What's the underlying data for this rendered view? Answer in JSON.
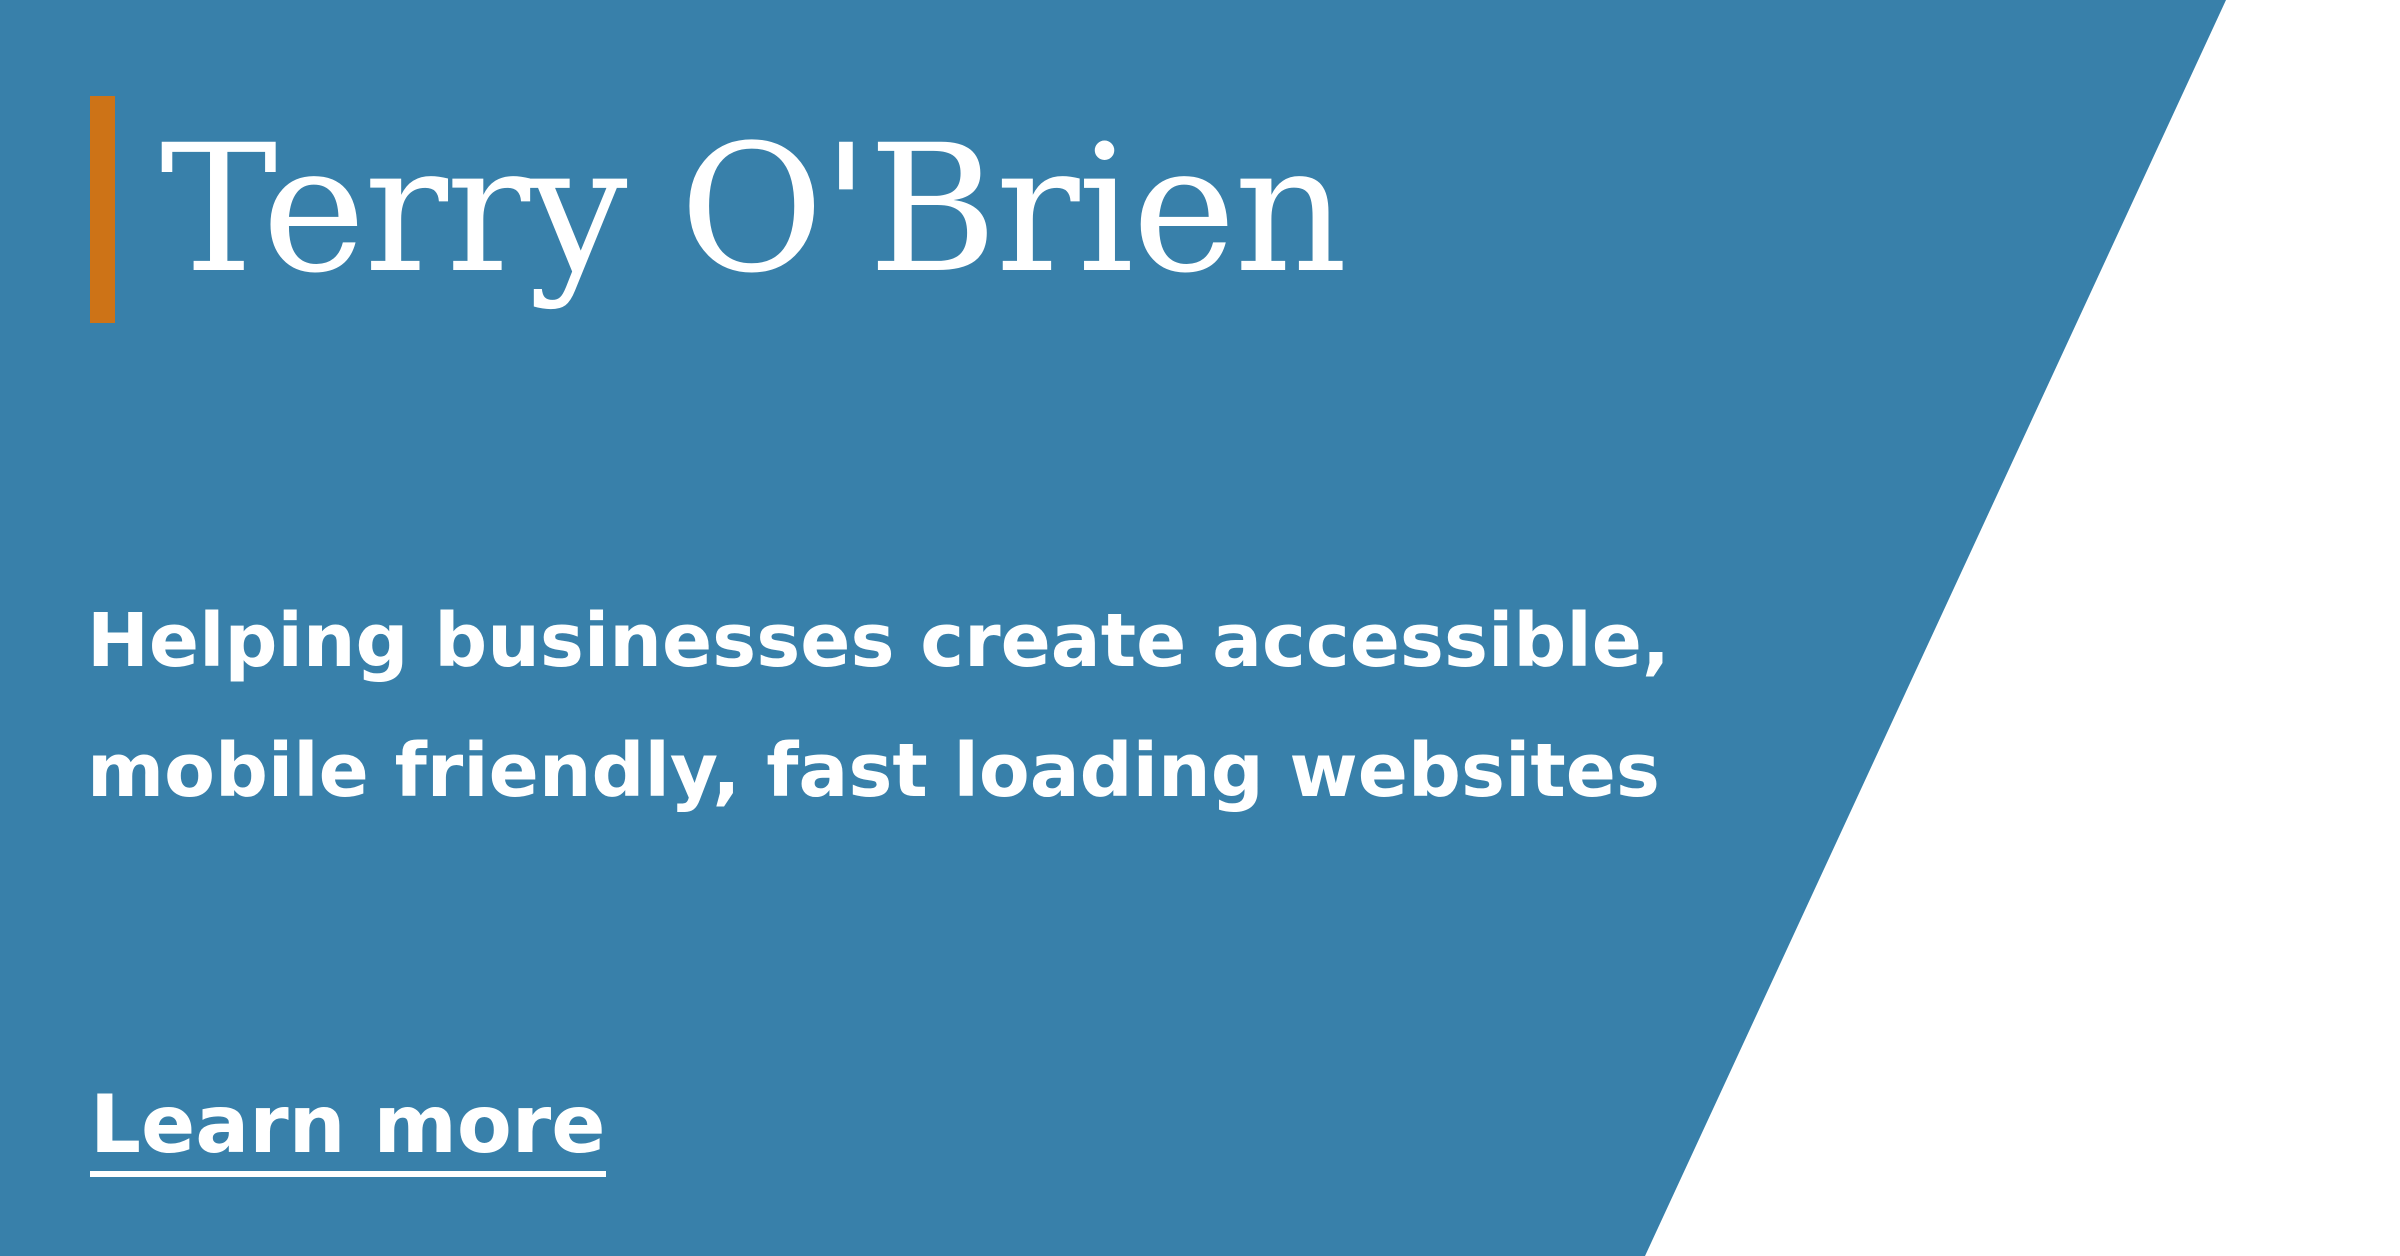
{
  "colors": {
    "panel_blue": "#3880aa",
    "accent_orange": "#cd7317",
    "text": "#ffffff",
    "background": "#ffffff"
  },
  "header": {
    "name": "Terry O'Brien"
  },
  "main": {
    "tagline_line_1": "Helping businesses create accessible,",
    "tagline_line_2": "mobile friendly, fast loading websites",
    "cta_label": "Learn more"
  }
}
